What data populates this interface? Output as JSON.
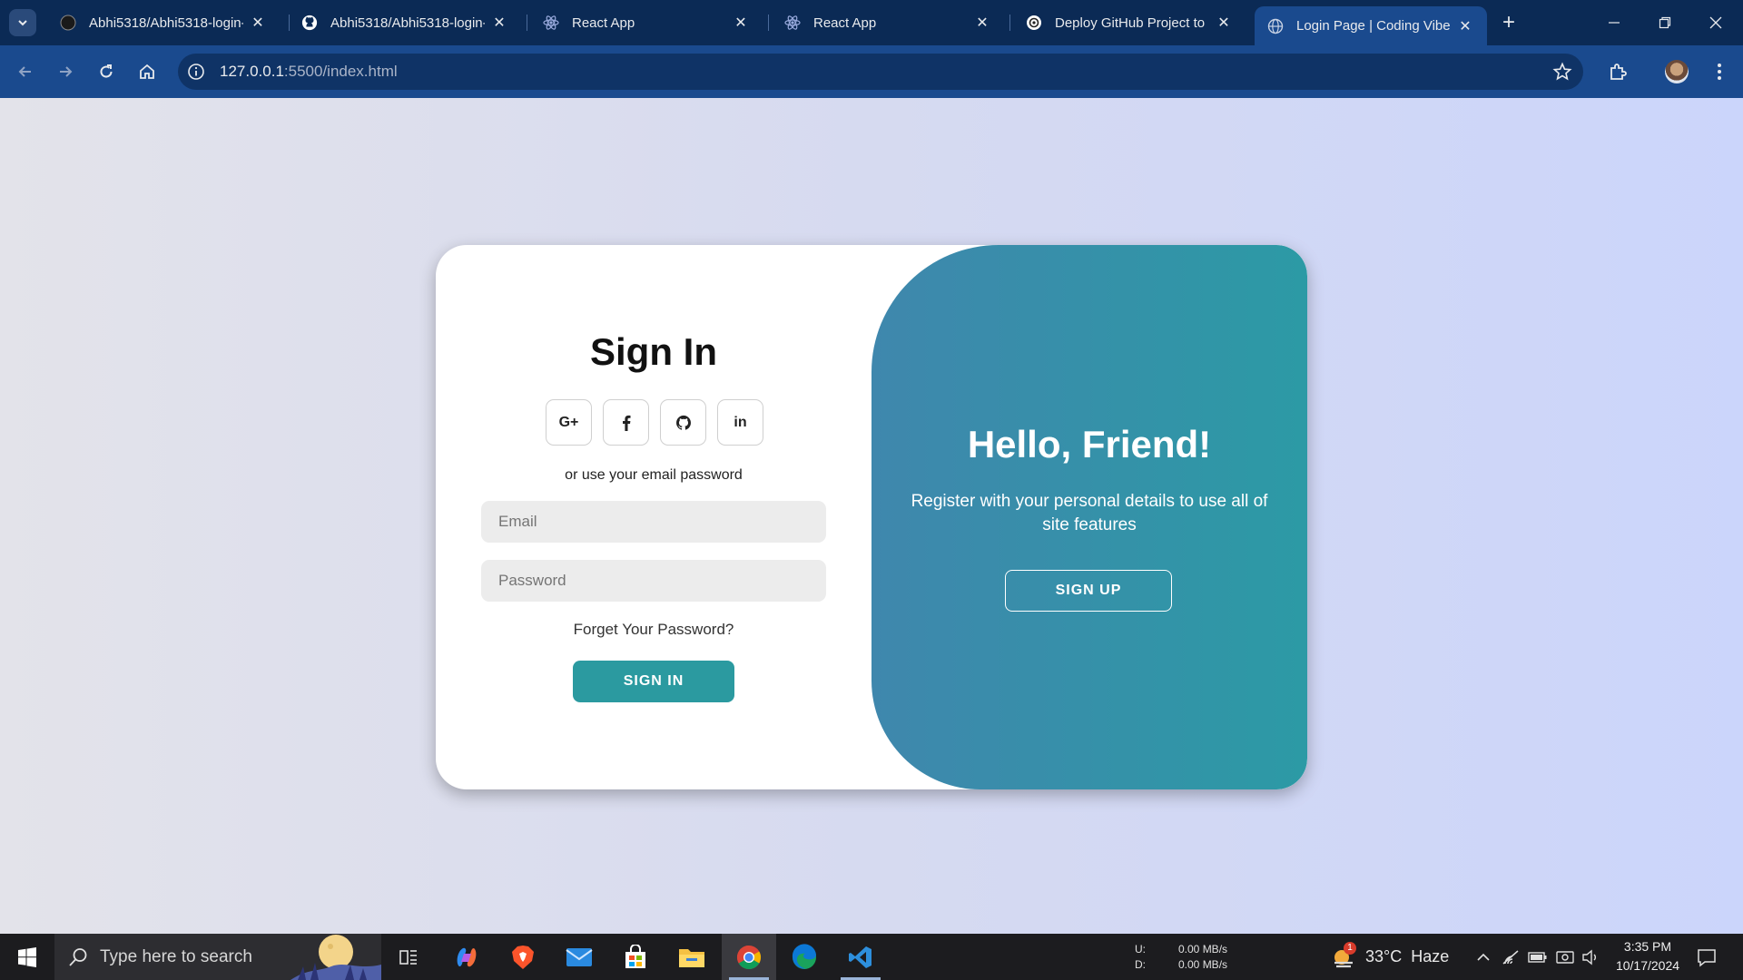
{
  "browser": {
    "tabs": [
      {
        "label": "Abhi5318/Abhi5318-login-",
        "icon": "github-icon",
        "active": false
      },
      {
        "label": "Abhi5318/Abhi5318-login-",
        "icon": "github-icon",
        "active": false
      },
      {
        "label": "React App",
        "icon": "react-icon",
        "active": false
      },
      {
        "label": "React App",
        "icon": "react-icon",
        "active": false
      },
      {
        "label": "Deploy GitHub Project to R",
        "icon": "openai-icon",
        "active": false
      },
      {
        "label": "Login Page | Coding Vibes",
        "icon": "globe-icon",
        "active": true
      }
    ],
    "new_tab": "+",
    "url_host": "127.0.0.1",
    "url_rest": ":5500/index.html"
  },
  "page": {
    "signin_title": "Sign In",
    "social_buttons": [
      "G+",
      "f",
      "github",
      "in"
    ],
    "or_text": "or use your email password",
    "email_placeholder": "Email",
    "password_placeholder": "Password",
    "forgot_text": "Forget Your Password?",
    "signin_button": "SIGN IN",
    "hello_title": "Hello, Friend!",
    "register_text": "Register with your personal details to use all of site features",
    "signup_button": "SIGN UP"
  },
  "colors": {
    "accent": "#2b9aa0",
    "panel_start": "#3f87ad",
    "panel_end": "#2c9aa5"
  },
  "taskbar": {
    "search_placeholder": "Type here to search",
    "net_up_label": "U:",
    "net_up_value": "0.00 MB/s",
    "net_down_label": "D:",
    "net_down_value": "0.00 MB/s",
    "weather_badge": "1",
    "temperature": "33°C",
    "weather_condition": "Haze",
    "time": "3:35 PM",
    "date": "10/17/2024"
  }
}
